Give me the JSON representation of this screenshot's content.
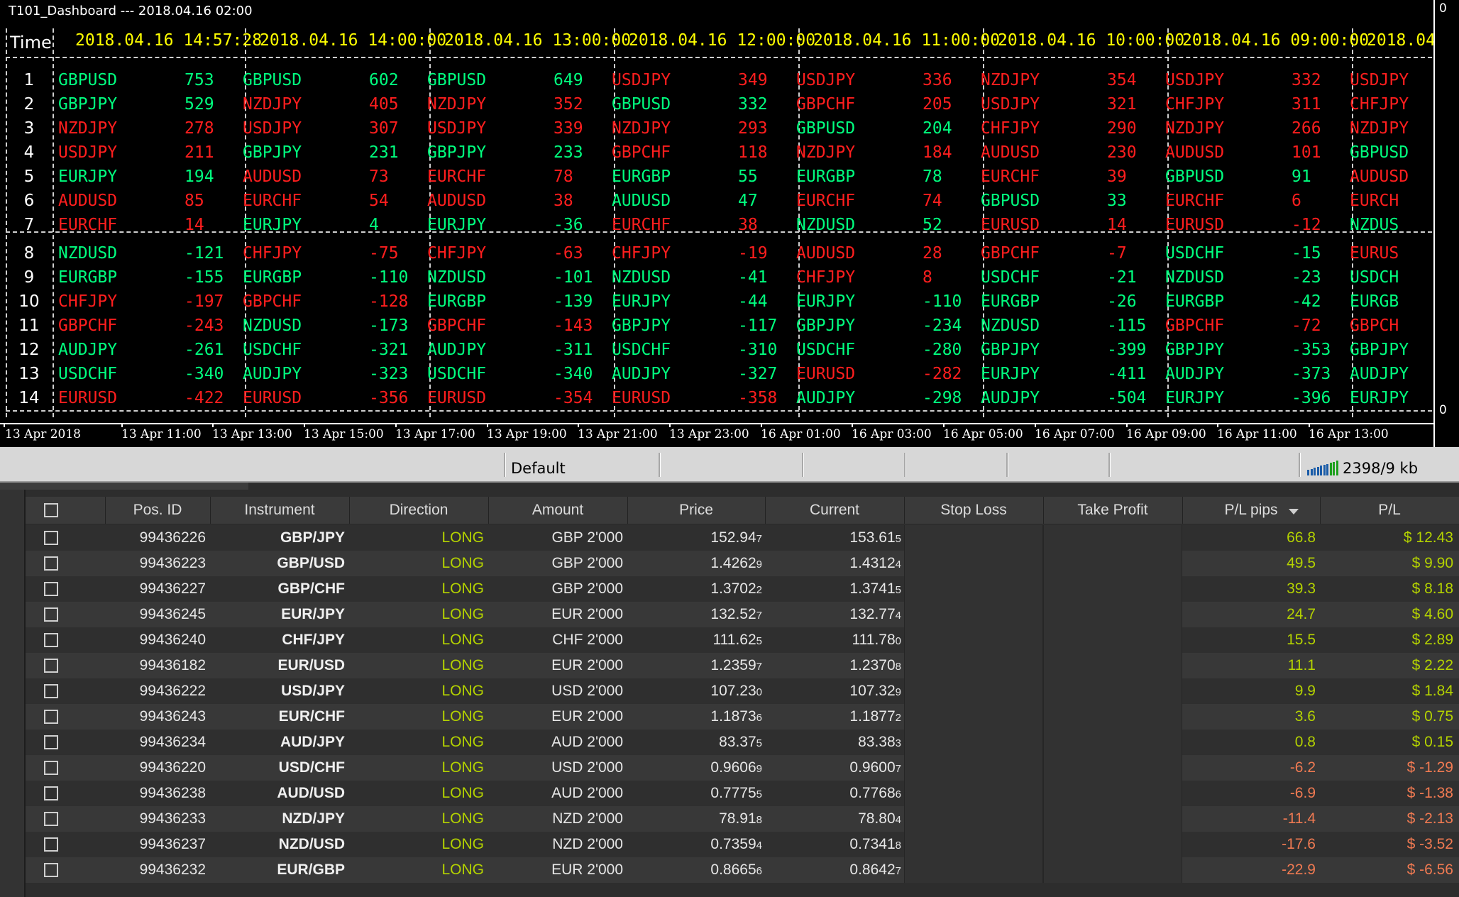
{
  "chart": {
    "title": "T101_Dashboard --- 2018.04.16 02:00",
    "scale_top": "0",
    "scale_bottom": "0",
    "time_label": "Time",
    "columns": [
      {
        "header": "2018.04.16 14:57:28",
        "rows": [
          [
            "GBPUSD",
            "753"
          ],
          [
            "GBPJPY",
            "529"
          ],
          [
            "NZDJPY",
            "278"
          ],
          [
            "USDJPY",
            "211"
          ],
          [
            "EURJPY",
            "194"
          ],
          [
            "AUDUSD",
            "85"
          ],
          [
            "EURCHF",
            "14"
          ],
          [
            "NZDUSD",
            "-121"
          ],
          [
            "EURGBP",
            "-155"
          ],
          [
            "CHFJPY",
            "-197"
          ],
          [
            "GBPCHF",
            "-243"
          ],
          [
            "AUDJPY",
            "-261"
          ],
          [
            "USDCHF",
            "-340"
          ],
          [
            "EURUSD",
            "-422"
          ]
        ]
      },
      {
        "header": "2018.04.16 14:00:00",
        "rows": [
          [
            "GBPUSD",
            "602"
          ],
          [
            "NZDJPY",
            "405"
          ],
          [
            "USDJPY",
            "307"
          ],
          [
            "GBPJPY",
            "231"
          ],
          [
            "AUDUSD",
            "73"
          ],
          [
            "EURCHF",
            "54"
          ],
          [
            "EURJPY",
            "4"
          ],
          [
            "CHFJPY",
            "-75"
          ],
          [
            "EURGBP",
            "-110"
          ],
          [
            "GBPCHF",
            "-128"
          ],
          [
            "NZDUSD",
            "-173"
          ],
          [
            "USDCHF",
            "-321"
          ],
          [
            "AUDJPY",
            "-323"
          ],
          [
            "EURUSD",
            "-356"
          ]
        ]
      },
      {
        "header": "2018.04.16 13:00:00",
        "rows": [
          [
            "GBPUSD",
            "649"
          ],
          [
            "NZDJPY",
            "352"
          ],
          [
            "USDJPY",
            "339"
          ],
          [
            "GBPJPY",
            "233"
          ],
          [
            "EURCHF",
            "78"
          ],
          [
            "AUDUSD",
            "38"
          ],
          [
            "EURJPY",
            "-36"
          ],
          [
            "CHFJPY",
            "-63"
          ],
          [
            "NZDUSD",
            "-101"
          ],
          [
            "EURGBP",
            "-139"
          ],
          [
            "GBPCHF",
            "-143"
          ],
          [
            "AUDJPY",
            "-311"
          ],
          [
            "USDCHF",
            "-340"
          ],
          [
            "EURUSD",
            "-354"
          ]
        ]
      },
      {
        "header": "2018.04.16 12:00:00",
        "rows": [
          [
            "USDJPY",
            "349"
          ],
          [
            "GBPUSD",
            "332"
          ],
          [
            "NZDJPY",
            "293"
          ],
          [
            "GBPCHF",
            "118"
          ],
          [
            "EURGBP",
            "55"
          ],
          [
            "AUDUSD",
            "47"
          ],
          [
            "EURCHF",
            "38"
          ],
          [
            "CHFJPY",
            "-19"
          ],
          [
            "NZDUSD",
            "-41"
          ],
          [
            "EURJPY",
            "-44"
          ],
          [
            "GBPJPY",
            "-117"
          ],
          [
            "USDCHF",
            "-310"
          ],
          [
            "AUDJPY",
            "-327"
          ],
          [
            "EURUSD",
            "-358"
          ]
        ]
      },
      {
        "header": "2018.04.16 11:00:00",
        "rows": [
          [
            "USDJPY",
            "336"
          ],
          [
            "GBPCHF",
            "205"
          ],
          [
            "GBPUSD",
            "204"
          ],
          [
            "NZDJPY",
            "184"
          ],
          [
            "EURGBP",
            "78"
          ],
          [
            "EURCHF",
            "74"
          ],
          [
            "NZDUSD",
            "52"
          ],
          [
            "AUDUSD",
            "28"
          ],
          [
            "CHFJPY",
            "8"
          ],
          [
            "EURJPY",
            "-110"
          ],
          [
            "GBPJPY",
            "-234"
          ],
          [
            "USDCHF",
            "-280"
          ],
          [
            "EURUSD",
            "-282"
          ],
          [
            "AUDJPY",
            "-298"
          ]
        ]
      },
      {
        "header": "2018.04.16 10:00:00",
        "rows": [
          [
            "NZDJPY",
            "354"
          ],
          [
            "USDJPY",
            "321"
          ],
          [
            "CHFJPY",
            "290"
          ],
          [
            "AUDUSD",
            "230"
          ],
          [
            "EURCHF",
            "39"
          ],
          [
            "GBPUSD",
            "33"
          ],
          [
            "EURUSD",
            "14"
          ],
          [
            "GBPCHF",
            "-7"
          ],
          [
            "USDCHF",
            "-21"
          ],
          [
            "EURGBP",
            "-26"
          ],
          [
            "NZDUSD",
            "-115"
          ],
          [
            "GBPJPY",
            "-399"
          ],
          [
            "EURJPY",
            "-411"
          ],
          [
            "AUDJPY",
            "-504"
          ]
        ]
      },
      {
        "header": "2018.04.16 09:00:00",
        "rows": [
          [
            "USDJPY",
            "332"
          ],
          [
            "CHFJPY",
            "311"
          ],
          [
            "NZDJPY",
            "266"
          ],
          [
            "AUDUSD",
            "101"
          ],
          [
            "GBPUSD",
            "91"
          ],
          [
            "EURCHF",
            "6"
          ],
          [
            "EURUSD",
            "-12"
          ],
          [
            "USDCHF",
            "-15"
          ],
          [
            "NZDUSD",
            "-23"
          ],
          [
            "EURGBP",
            "-42"
          ],
          [
            "GBPCHF",
            "-72"
          ],
          [
            "GBPJPY",
            "-353"
          ],
          [
            "AUDJPY",
            "-373"
          ],
          [
            "EURJPY",
            "-396"
          ]
        ]
      },
      {
        "header": "2018.04",
        "rows": [
          [
            "USDJPY",
            ""
          ],
          [
            "CHFJPY",
            ""
          ],
          [
            "NZDJPY",
            ""
          ],
          [
            "GBPUSD",
            ""
          ],
          [
            "AUDUSD",
            ""
          ],
          [
            "EURCH",
            ""
          ],
          [
            "NZDUS",
            ""
          ],
          [
            "EURUS",
            ""
          ],
          [
            "USDCH",
            ""
          ],
          [
            "EURGB",
            ""
          ],
          [
            "GBPCH",
            ""
          ],
          [
            "GBPJPY",
            ""
          ],
          [
            "AUDJPY",
            ""
          ],
          [
            "EURJPY",
            ""
          ]
        ]
      }
    ],
    "time_axis": [
      "13 Apr 2018",
      "13 Apr 11:00",
      "13 Apr 13:00",
      "13 Apr 15:00",
      "13 Apr 17:00",
      "13 Apr 19:00",
      "13 Apr 21:00",
      "13 Apr 23:00",
      "16 Apr 01:00",
      "16 Apr 03:00",
      "16 Apr 05:00",
      "16 Apr 07:00",
      "16 Apr 09:00",
      "16 Apr 11:00",
      "16 Apr 13:00"
    ]
  },
  "statusbar": {
    "profile": "Default",
    "traffic": "2398/9 kb"
  },
  "colors": {
    "positive": "#00ff7f",
    "negative": "#ff1e1e",
    "header": "#ffff00",
    "long": "#b4d200",
    "loss": "#f07a52"
  },
  "grid": {
    "headers": [
      "Pos. ID",
      "Instrument",
      "Direction",
      "Amount",
      "Price",
      "Current",
      "Stop Loss",
      "Take Profit",
      "P/L pips",
      "P/L"
    ],
    "rows": [
      {
        "id": "99436226",
        "inst": "GBP/JPY",
        "dir": "LONG",
        "amount": "GBP 2'000",
        "price": "152.94",
        "price_sub": "7",
        "current": "153.61",
        "current_sub": "5",
        "pips": "66.8",
        "pl": "$ 12.43",
        "loss": false
      },
      {
        "id": "99436223",
        "inst": "GBP/USD",
        "dir": "LONG",
        "amount": "GBP 2'000",
        "price": "1.4262",
        "price_sub": "9",
        "current": "1.4312",
        "current_sub": "4",
        "pips": "49.5",
        "pl": "$ 9.90",
        "loss": false
      },
      {
        "id": "99436227",
        "inst": "GBP/CHF",
        "dir": "LONG",
        "amount": "GBP 2'000",
        "price": "1.3702",
        "price_sub": "2",
        "current": "1.3741",
        "current_sub": "5",
        "pips": "39.3",
        "pl": "$ 8.18",
        "loss": false
      },
      {
        "id": "99436245",
        "inst": "EUR/JPY",
        "dir": "LONG",
        "amount": "EUR 2'000",
        "price": "132.52",
        "price_sub": "7",
        "current": "132.77",
        "current_sub": "4",
        "pips": "24.7",
        "pl": "$ 4.60",
        "loss": false
      },
      {
        "id": "99436240",
        "inst": "CHF/JPY",
        "dir": "LONG",
        "amount": "CHF 2'000",
        "price": "111.62",
        "price_sub": "5",
        "current": "111.78",
        "current_sub": "0",
        "pips": "15.5",
        "pl": "$ 2.89",
        "loss": false
      },
      {
        "id": "99436182",
        "inst": "EUR/USD",
        "dir": "LONG",
        "amount": "EUR 2'000",
        "price": "1.2359",
        "price_sub": "7",
        "current": "1.2370",
        "current_sub": "8",
        "pips": "11.1",
        "pl": "$ 2.22",
        "loss": false
      },
      {
        "id": "99436222",
        "inst": "USD/JPY",
        "dir": "LONG",
        "amount": "USD 2'000",
        "price": "107.23",
        "price_sub": "0",
        "current": "107.32",
        "current_sub": "9",
        "pips": "9.9",
        "pl": "$ 1.84",
        "loss": false
      },
      {
        "id": "99436243",
        "inst": "EUR/CHF",
        "dir": "LONG",
        "amount": "EUR 2'000",
        "price": "1.1873",
        "price_sub": "6",
        "current": "1.1877",
        "current_sub": "2",
        "pips": "3.6",
        "pl": "$ 0.75",
        "loss": false
      },
      {
        "id": "99436234",
        "inst": "AUD/JPY",
        "dir": "LONG",
        "amount": "AUD 2'000",
        "price": "83.37",
        "price_sub": "5",
        "current": "83.38",
        "current_sub": "3",
        "pips": "0.8",
        "pl": "$ 0.15",
        "loss": false
      },
      {
        "id": "99436220",
        "inst": "USD/CHF",
        "dir": "LONG",
        "amount": "USD 2'000",
        "price": "0.9606",
        "price_sub": "9",
        "current": "0.9600",
        "current_sub": "7",
        "pips": "-6.2",
        "pl": "$ -1.29",
        "loss": true
      },
      {
        "id": "99436238",
        "inst": "AUD/USD",
        "dir": "LONG",
        "amount": "AUD 2'000",
        "price": "0.7775",
        "price_sub": "5",
        "current": "0.7768",
        "current_sub": "6",
        "pips": "-6.9",
        "pl": "$ -1.38",
        "loss": true
      },
      {
        "id": "99436233",
        "inst": "NZD/JPY",
        "dir": "LONG",
        "amount": "NZD 2'000",
        "price": "78.91",
        "price_sub": "8",
        "current": "78.80",
        "current_sub": "4",
        "pips": "-11.4",
        "pl": "$ -2.13",
        "loss": true
      },
      {
        "id": "99436237",
        "inst": "NZD/USD",
        "dir": "LONG",
        "amount": "NZD 2'000",
        "price": "0.7359",
        "price_sub": "4",
        "current": "0.7341",
        "current_sub": "8",
        "pips": "-17.6",
        "pl": "$ -3.52",
        "loss": true
      },
      {
        "id": "99436232",
        "inst": "EUR/GBP",
        "dir": "LONG",
        "amount": "EUR 2'000",
        "price": "0.8665",
        "price_sub": "6",
        "current": "0.8642",
        "current_sub": "7",
        "pips": "-22.9",
        "pl": "$ -6.56",
        "loss": true
      }
    ]
  }
}
